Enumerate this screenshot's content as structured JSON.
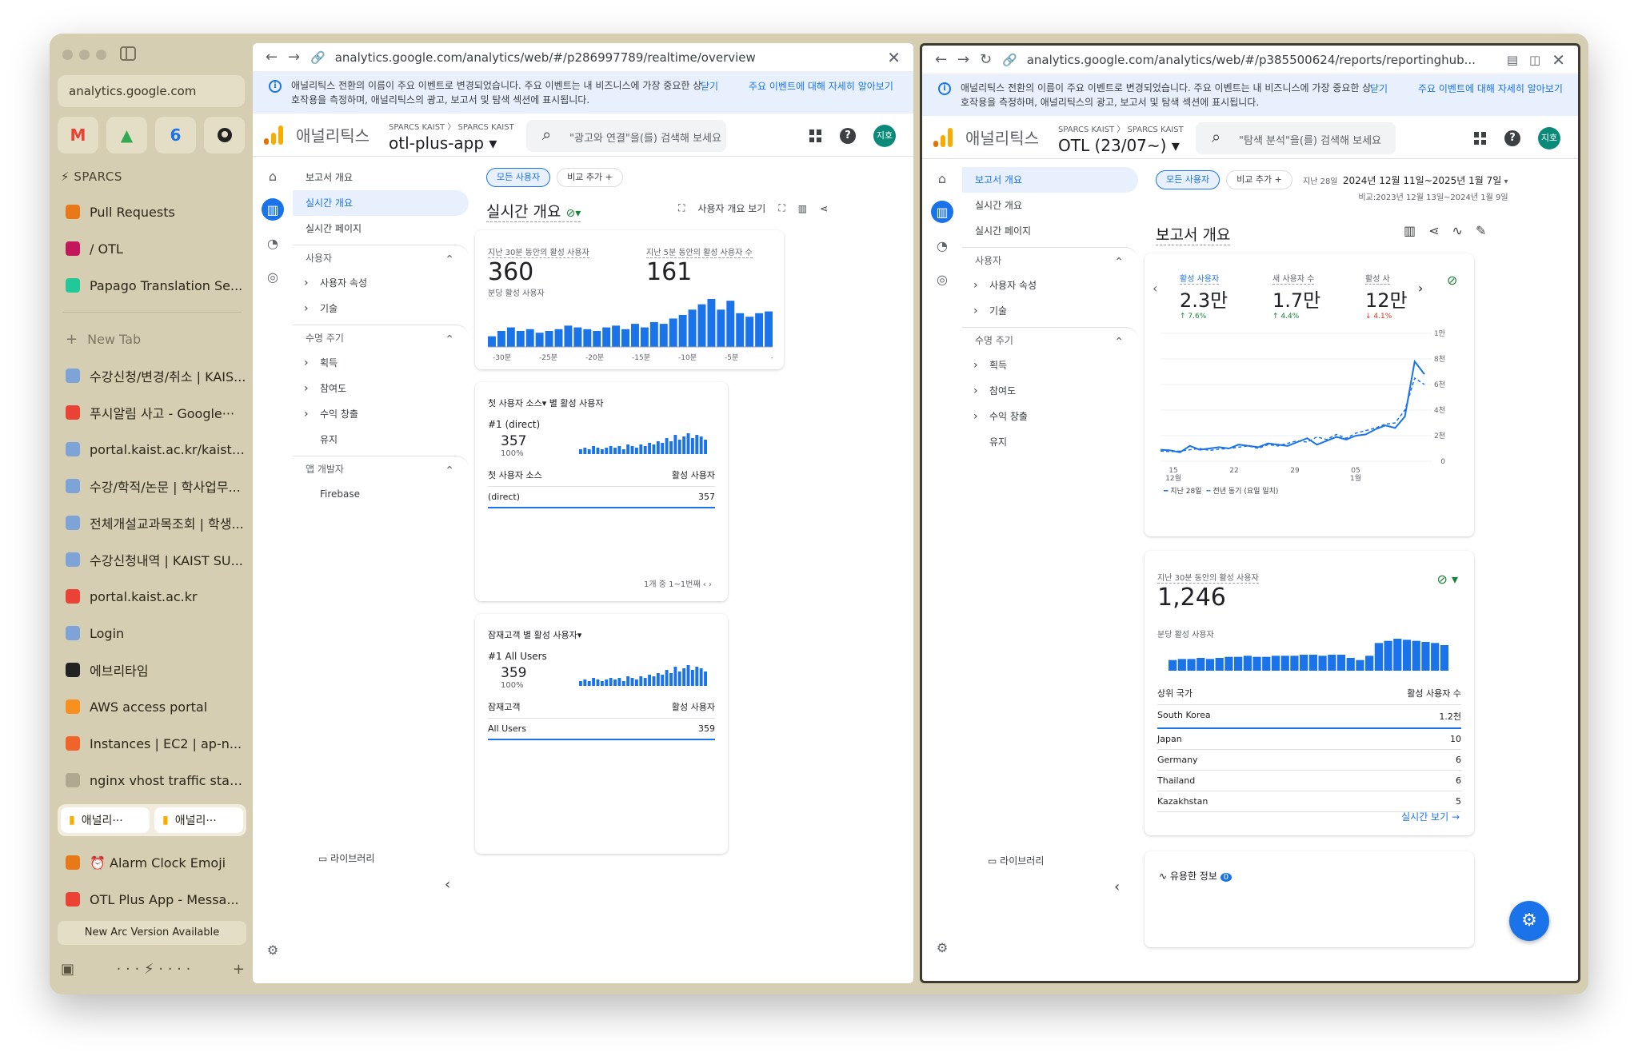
{
  "sidebar": {
    "url": "analytics.google.com",
    "favorites": [
      "M",
      "▲",
      "6",
      ""
    ],
    "space": "SPARCS",
    "pinned": [
      {
        "label": "Pull Requests",
        "color": "#e8791a"
      },
      {
        "label": "/ OTL",
        "color": "#c2185b"
      },
      {
        "label": "Papago Translation Se...",
        "color": "#20c997"
      }
    ],
    "new_tab": "New Tab",
    "tabs": [
      {
        "label": "수강신청/변경/취소 | KAIS...",
        "color": "#7ea3d6"
      },
      {
        "label": "푸시알림 사고 - Google···",
        "color": "#ea4335"
      },
      {
        "label": "portal.kaist.ac.kr/kaist/...",
        "color": "#7ea3d6"
      },
      {
        "label": "수강/학적/논문 | 학사업무...",
        "color": "#7ea3d6"
      },
      {
        "label": "전체개설교과목조회 | 학생...",
        "color": "#7ea3d6"
      },
      {
        "label": "수강신청내역 | KAIST SU...",
        "color": "#7ea3d6"
      },
      {
        "label": "portal.kaist.ac.kr",
        "color": "#ea4335"
      },
      {
        "label": "Login",
        "color": "#7ea3d6"
      },
      {
        "label": "에브리타임",
        "color": "#222222"
      },
      {
        "label": "AWS access portal",
        "color": "#f7901e"
      },
      {
        "label": "Instances | EC2 | ap-n...",
        "color": "#f0642a"
      },
      {
        "label": "nginx vhost traffic stat...",
        "color": "#b0a88f"
      }
    ],
    "active_pair": [
      "애널리···",
      "애널리···"
    ],
    "after_tabs": [
      {
        "label": "⏰ Alarm Clock Emoji",
        "color": "#e8791a"
      },
      {
        "label": "OTL Plus App - Messa...",
        "color": "#ea4335"
      }
    ],
    "new_version": "New Arc Version Available"
  },
  "banner": {
    "text": "애널리틱스 전환의 이름이 주요 이벤트로 변경되었습니다. 주요 이벤트는 내 비즈니스에 가장 중요한 상호작용을 측정하며, 애널리틱스의 광고, 보고서 및 탐색 섹션에 표시됩니다.",
    "close": "닫기",
    "more": "주요 이벤트에 대해 자세히 알아보기"
  },
  "ga_title": "애널리틱스",
  "left": {
    "url": "analytics.google.com/analytics/web/#/p286997789/realtime/overview",
    "crumb": "SPARCS KAIST 〉 SPARCS KAIST",
    "property": "otl-plus-app ▾",
    "search": "\"광고와 연결\"을(를) 검색해 보세요",
    "avatar": "지호",
    "nav": {
      "overview": "보고서 개요",
      "realtime": "실시간 개요",
      "realtime_page": "실시간 페이지",
      "users": "사용자",
      "user_attr": "사용자 속성",
      "tech": "기술",
      "lifecycle": "수명 주기",
      "acq": "획득",
      "eng": "참여도",
      "mon": "수익 창출",
      "ret": "유지",
      "app_dev": "앱 개발자",
      "firebase": "Firebase",
      "library": "라이브러리"
    },
    "chips": [
      "모든 사용자",
      "비교 추가 +"
    ],
    "title": "실시간 개요",
    "tools": "사용자 개요 보기",
    "c1": {
      "l1": "지난 30분 동안의 활성 사용자",
      "v1": "360",
      "l2": "지난 5분 동안의 활성 사용자 수",
      "v2": "161",
      "sub": "분당 활성 사용자",
      "ticks": [
        "-30분",
        "-25분",
        "-20분",
        "-15분",
        "-10분",
        "-5분",
        "-1분"
      ],
      "bars": [
        6,
        9,
        11,
        9,
        10,
        8,
        9,
        10,
        12,
        11,
        10,
        9,
        11,
        12,
        10,
        13,
        11,
        14,
        13,
        16,
        18,
        21,
        24,
        27,
        21,
        26,
        19,
        17,
        19,
        20
      ]
    },
    "c2": {
      "head": "첫 사용자 소스▾ 별 활성 사용자",
      "rank": "#1  (direct)",
      "value": "357",
      "pct": "100%",
      "col1": "첫 사용자 소스",
      "col2": "활성 사용자",
      "row_name": "(direct)",
      "row_val": "357",
      "pager": "1개 중 1~1번째"
    },
    "c3": {
      "head": "잠재고객 별 활성 사용자▾",
      "rank": "#1  All Users",
      "value": "359",
      "pct": "100%",
      "col1": "잠재고객",
      "col2": "활성 사용자",
      "row_name": "All Users",
      "row_val": "359"
    },
    "mini": [
      3,
      4,
      3,
      5,
      4,
      3,
      4,
      5,
      4,
      5,
      3,
      6,
      5,
      4,
      6,
      5,
      7,
      6,
      8,
      7,
      10,
      8,
      12,
      9,
      11,
      13,
      10,
      12,
      11,
      9
    ]
  },
  "right": {
    "url": "analytics.google.com/analytics/web/#/p385500624/reports/reportinghub...",
    "crumb": "SPARCS KAIST 〉 SPARCS KAIST",
    "property": "OTL (23/07~) ▾",
    "search": "\"탐색 분석\"을(를) 검색해 보세요",
    "avatar": "지호",
    "date_label": "지난 28일",
    "date_range": "2024년 12월 11일~2025년 1월 7일",
    "compare": "비교:2023년 12월 13일~2024년 1월 9일",
    "title": "보고서 개요",
    "kpis": [
      {
        "label": "활성 사용자",
        "value": "2.3만",
        "delta": "↑ 7.6%",
        "up": true
      },
      {
        "label": "새 사용자 수",
        "value": "1.7만",
        "delta": "↑ 4.4%",
        "up": true
      },
      {
        "label": "활성 사",
        "value": "12만",
        "delta": "↓ 4.1%",
        "up": false
      }
    ],
    "yticks": [
      "1만",
      "8천",
      "6천",
      "4천",
      "2천",
      "0"
    ],
    "xticks": [
      "15\n12월",
      "22",
      "29",
      "05\n1월"
    ],
    "legend1": "지난 28일",
    "legend2": "전년 동기 (요일 일치)",
    "line_current": [
      900,
      850,
      700,
      1200,
      900,
      1000,
      1100,
      1000,
      1300,
      1200,
      1100,
      1400,
      1300,
      1200,
      1500,
      1800,
      1300,
      1600,
      1900,
      1700,
      2000,
      2100,
      2500,
      2800,
      2600,
      3500,
      7800,
      6800
    ],
    "line_prev": [
      800,
      750,
      800,
      900,
      1000,
      850,
      950,
      1000,
      1100,
      1200,
      1000,
      1300,
      1200,
      1400,
      1600,
      1500,
      1900,
      1700,
      2100,
      1800,
      2200,
      2400,
      2600,
      2900,
      3000,
      4000,
      6500,
      6000
    ],
    "rt": {
      "label": "지난 30분 동안의 활성 사용자",
      "value": "1,246",
      "sub": "분당 활성 사용자",
      "bars": [
        10,
        11,
        11,
        12,
        11,
        12,
        13,
        13,
        14,
        13,
        13,
        14,
        14,
        14,
        15,
        15,
        14,
        15,
        15,
        12,
        10,
        14,
        26,
        28,
        30,
        29,
        28,
        27,
        26,
        24
      ],
      "col1": "상위 국가",
      "col2": "활성 사용자 수",
      "rows": [
        [
          "South Korea",
          "1.2천"
        ],
        [
          "Japan",
          "10"
        ],
        [
          "Germany",
          "6"
        ],
        [
          "Thailand",
          "6"
        ],
        [
          "Kazakhstan",
          "5"
        ]
      ],
      "link": "실시간 보기 →"
    },
    "insights": "유용한 정보",
    "insights_count": "0"
  }
}
